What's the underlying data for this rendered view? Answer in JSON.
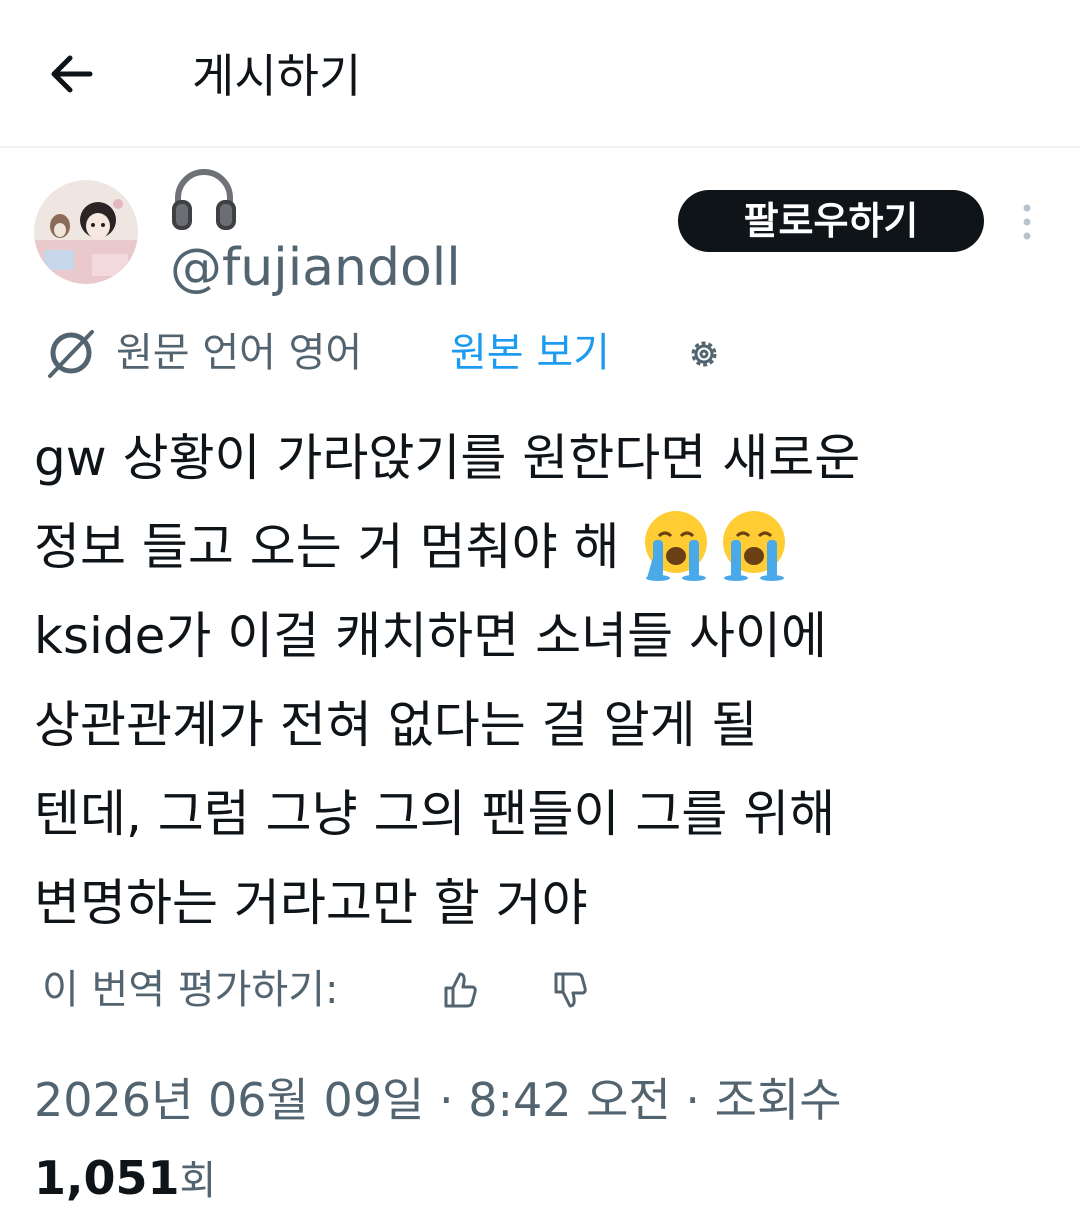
{
  "header": {
    "title": "게시하기"
  },
  "author": {
    "display_name_icon": "headphones-emoji",
    "handle": "@fujiandoll",
    "follow_label": "팔로우하기"
  },
  "translation": {
    "icon": "translate-icon",
    "original_language": "원문 언어 영어",
    "view_original_label": "원본 보기",
    "settings_icon": "gear-icon"
  },
  "tweet": {
    "lines": [
      "gw 상황이 가라앉기를 원한다면 새로운",
      "정보 들고 오는 거 멈춰야 해",
      "kside가 이걸 캐치하면 소녀들 사이에",
      "상관관계가 전혀 없다는 걸 알게 될",
      "텐데, 그럼 그냥 그의 팬들이 그를 위해",
      "변명하는 거라고만 할 거야"
    ],
    "emoji": [
      "crying-face-emoji",
      "crying-face-emoji"
    ]
  },
  "rating": {
    "label": "이 번역 평가하기:",
    "thumbs_up_icon": "thumbs-up-icon",
    "thumbs_down_icon": "thumbs-down-icon"
  },
  "meta": {
    "timestamp": "2026년 06월 09일 · 8:42 오전 · 조회수",
    "views_count": "1,051",
    "views_unit": "회"
  },
  "colors": {
    "text_primary": "#0f1419",
    "text_secondary": "#536471",
    "link_blue": "#1d9bf0",
    "follow_bg": "#0f1419"
  }
}
